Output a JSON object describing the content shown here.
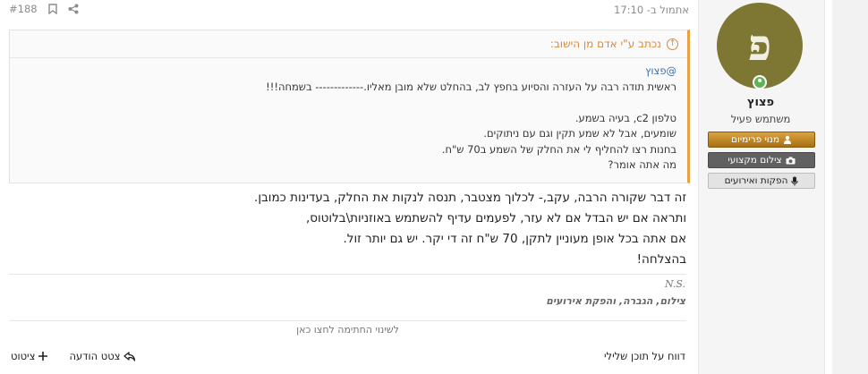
{
  "post": {
    "number": "#188",
    "timestamp": "אתמול ב- 17:10",
    "quote": {
      "header": "נכתב ע\"י אדם מן הישוב:",
      "mention": "@פצוץ",
      "lines": [
        "ראשית תודה רבה על העזרה והסיוע בחפץ לב, בהחלט שלא מובן מאליו.------------- בשמחה!!!",
        "טלפון c2, בעיה בשמע.",
        "שומעים, אבל לא שמע תקין וגם עם ניתוקים.",
        "בחנות רצו להחליף לי את החלק של השמע ב70 ש\"ח.",
        "מה אתה אומר?"
      ]
    },
    "content_lines": [
      "זה דבר שקורה הרבה, עקב,- לכלוך מצטבר, תנסה לנקות את החלק, בעדינות כמובן.",
      "ותראה אם יש הבדל אם לא עזר, לפעמים עדיף להשתמש באוזניות\\בלוטוס,",
      "אם אתה בכל אופן מעוניין לתקן, 70 ש\"ח זה די יקר. יש גם יותר זול.",
      "בהצלחה!"
    ],
    "signature": {
      "line1": "N.S.",
      "line2": "צילום, הגברה, והפקת אירועים",
      "edit_hint": "לשינוי החתימה לחצו כאן"
    },
    "footer": {
      "report": "דווח על תוכן שלילי",
      "quote_label": "ציטוט",
      "quote_message": "צטט הודעה"
    }
  },
  "user": {
    "avatar_letter": "פ",
    "name": "פצוץ",
    "title": "משתמש פעיל",
    "badges": [
      "מנוי פרימיום",
      "צילום מקצועי",
      "הפקות ואירועים"
    ]
  },
  "colors": {
    "avatar_bg": "#7e7733",
    "quote_accent": "#e8a142",
    "premium_badge": "#c48a2a",
    "online": "#5fb357"
  }
}
